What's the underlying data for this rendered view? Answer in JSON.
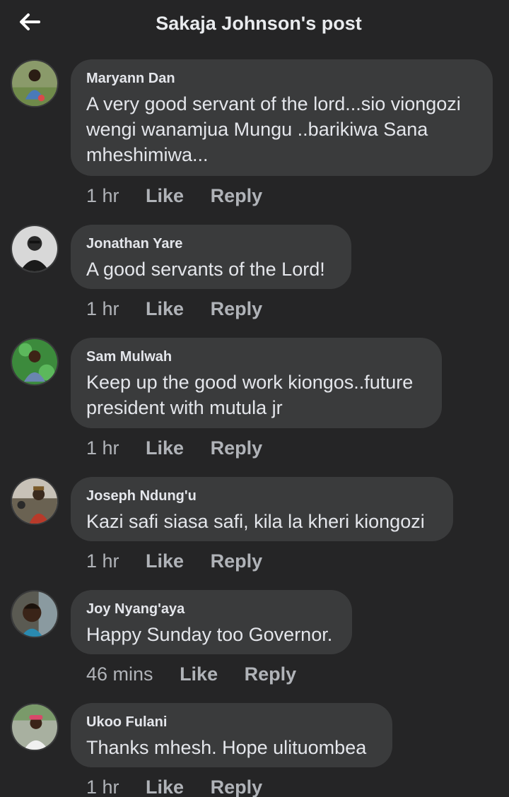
{
  "header": {
    "title": "Sakaja Johnson's post",
    "back_icon": "arrow-left-icon"
  },
  "comments": [
    {
      "author": "Maryann Dan",
      "text_lines": [
        "A very good servant of the lord...sio viongozi",
        "wengi wanamjua Mungu ..barikiwa Sana",
        "mheshimiwa..."
      ],
      "time": "1 hr",
      "like": "Like",
      "reply": "Reply"
    },
    {
      "author": "Jonathan Yare",
      "text_lines": [
        "A good servants of the Lord!"
      ],
      "time": "1 hr",
      "like": "Like",
      "reply": "Reply"
    },
    {
      "author": "Sam Mulwah",
      "text_lines": [
        "Keep up the good work kiongos..future",
        "president with mutula jr"
      ],
      "time": "1 hr",
      "like": "Like",
      "reply": "Reply"
    },
    {
      "author": "Joseph Ndung'u",
      "text_lines": [
        "Kazi safi siasa safi, kila la kheri kiongozi"
      ],
      "time": "1 hr",
      "like": "Like",
      "reply": "Reply"
    },
    {
      "author": "Joy Nyang'aya",
      "text_lines": [
        "Happy Sunday too Governor."
      ],
      "time": "46 mins",
      "like": "Like",
      "reply": "Reply"
    },
    {
      "author": "Ukoo Fulani",
      "text_lines": [
        "Thanks mhesh. Hope ulituombea"
      ],
      "time": "1 hr",
      "like": "Like",
      "reply": "Reply"
    }
  ],
  "colors": {
    "background": "#252526",
    "bubble": "#3a3b3c",
    "text": "#e4e6eb",
    "meta": "#b0b3b8"
  }
}
